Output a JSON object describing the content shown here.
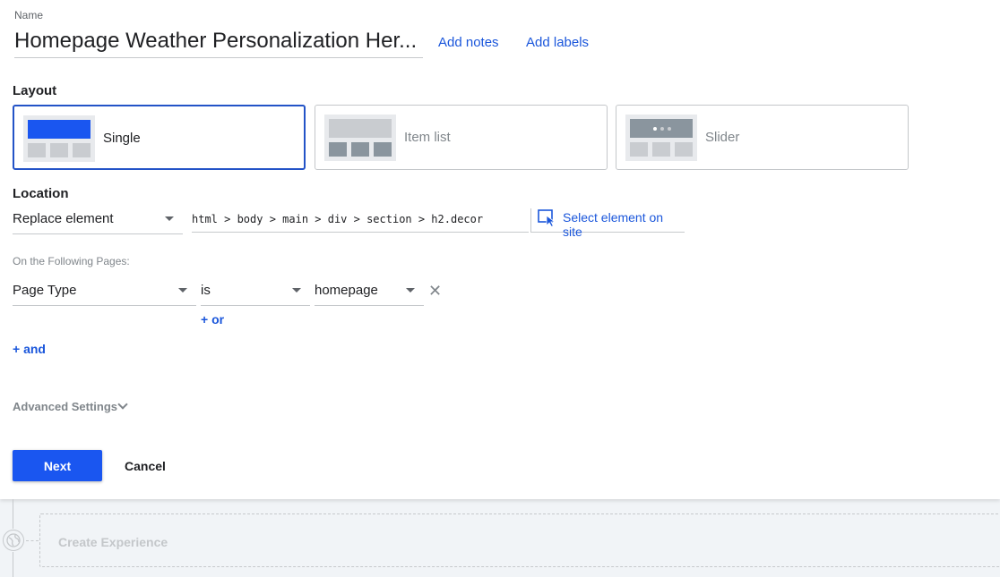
{
  "name": {
    "label": "Name",
    "value": "Homepage Weather Personalization Her..."
  },
  "links": {
    "add_notes": "Add notes",
    "add_labels": "Add labels"
  },
  "layout": {
    "title": "Layout",
    "options": [
      {
        "label": "Single",
        "selected": true
      },
      {
        "label": "Item list",
        "selected": false
      },
      {
        "label": "Slider",
        "selected": false
      }
    ]
  },
  "location": {
    "title": "Location",
    "mode": "Replace element",
    "selector": "html > body > main > div > section > h2.decor",
    "select_element_label": "Select element on site"
  },
  "pages": {
    "label": "On the Following Pages:",
    "rule": {
      "field": "Page Type",
      "operator": "is",
      "value": "homepage"
    },
    "or_label": "+ or",
    "and_label": "+ and"
  },
  "advanced": {
    "label": "Advanced Settings"
  },
  "actions": {
    "next": "Next",
    "cancel": "Cancel"
  },
  "bottom": {
    "create_experience": "Create Experience"
  },
  "colors": {
    "accent": "#1a56f0",
    "link": "#1a56db",
    "selected_border": "#2353c7"
  }
}
